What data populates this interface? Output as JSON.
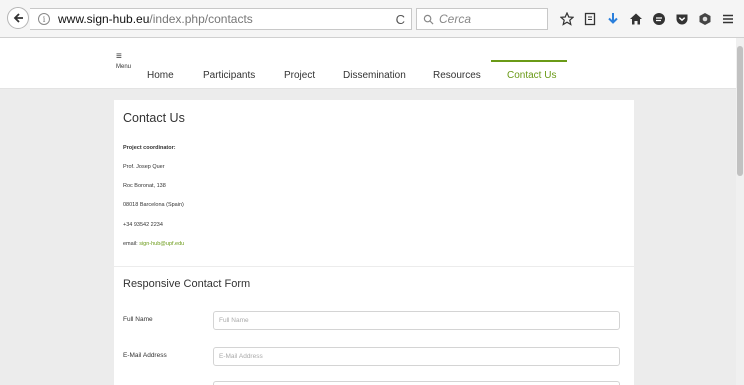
{
  "browser": {
    "url_host": "www.sign-hub.eu",
    "url_path": "/index.php/contacts",
    "search_placeholder": "Cerca",
    "info_glyph": "i",
    "reload_glyph": "C"
  },
  "nav": {
    "menu_label": "Menu",
    "hamburger_glyph": "≡",
    "items": [
      "Home",
      "Participants",
      "Project",
      "Dissemination",
      "Resources",
      "Contact Us"
    ],
    "active": "Contact Us"
  },
  "contact": {
    "title": "Contact Us",
    "coordinator_label": "Project coordinator:",
    "name": "Prof. Josep Quer",
    "street": "Roc Boronat, 138",
    "city": "08018 Barcelona (Spain)",
    "phone": "+34 93542 2234",
    "email_label": "email:",
    "email": "sign-hub@upf.edu"
  },
  "form": {
    "title": "Responsive Contact Form",
    "fullname_label": "Full Name",
    "fullname_placeholder": "Full Name",
    "email_label": "E-Mail Address",
    "email_placeholder": "E-Mail Address"
  },
  "colors": {
    "accent": "#6a9a17",
    "background": "#ececec",
    "toolbar": "#f5f5f5"
  },
  "icons": [
    "back-arrow-icon",
    "info-icon",
    "reload-icon",
    "search-icon",
    "star-icon",
    "reading-list-icon",
    "download-icon",
    "home-icon",
    "chat-icon",
    "pocket-icon",
    "shield-icon",
    "hamburger-menu-icon"
  ]
}
